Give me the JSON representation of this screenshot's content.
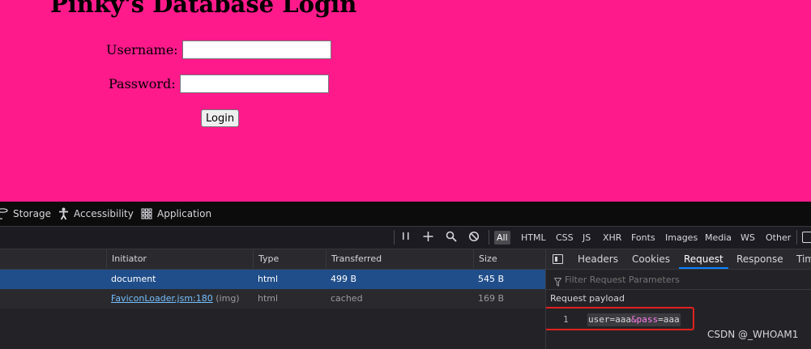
{
  "page": {
    "title": "Pinky's Database Login",
    "username_label": "Username:",
    "username_value": "",
    "password_label": "Password:",
    "password_value": "",
    "login_button": "Login",
    "background": "#ff1a8c"
  },
  "devtools": {
    "panel_tabs": [
      {
        "label": "Storage",
        "icon": "storage-icon"
      },
      {
        "label": "Accessibility",
        "icon": "accessibility-icon"
      },
      {
        "label": "Application",
        "icon": "application-icon"
      }
    ],
    "toolbar": {
      "icons": [
        "pause-icon",
        "add-icon",
        "search-icon",
        "block-icon"
      ],
      "filters": [
        "All",
        "HTML",
        "CSS",
        "JS",
        "XHR",
        "Fonts",
        "Images",
        "Media",
        "WS",
        "Other"
      ],
      "active_filter": "All"
    },
    "table": {
      "columns": [
        "Initiator",
        "Type",
        "Transferred",
        "Size"
      ],
      "rows": [
        {
          "initiator": "document",
          "initiator_detail": "",
          "type": "html",
          "transferred": "499 B",
          "size": "545 B",
          "selected": true
        },
        {
          "initiator": "FaviconLoader.jsm:180",
          "initiator_detail": "(img)",
          "type": "html",
          "transferred": "cached",
          "size": "169 B",
          "selected": false
        }
      ]
    },
    "details": {
      "tabs": [
        "Headers",
        "Cookies",
        "Request",
        "Response",
        "Timings"
      ],
      "visible_tabs": [
        "Headers",
        "Cookies",
        "Request",
        "Response",
        "Tim"
      ],
      "active_tab": "Request",
      "filter_placeholder": "Filter Request Parameters",
      "payload_heading": "Request payload",
      "payload_line_number": "1",
      "payload_tokens": [
        "user",
        "=",
        "aaa",
        "&",
        "pass",
        "=",
        "aaa"
      ]
    }
  },
  "watermark": "CSDN @_WHOAM1"
}
